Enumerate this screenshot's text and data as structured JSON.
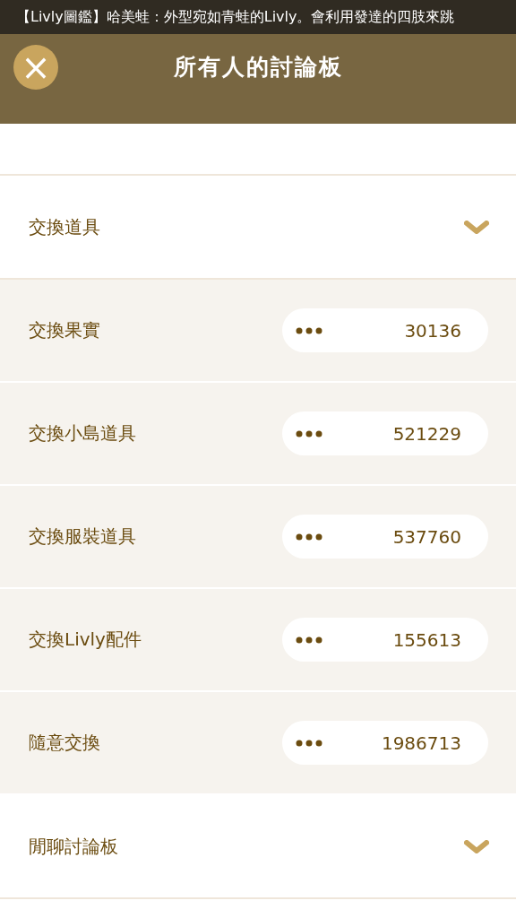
{
  "ticker": "【Livly圖鑑】哈美蛙：外型宛如青蛙的Livly。會利用發達的四肢來跳",
  "header": {
    "close_icon": "×",
    "title": "所有人的討論板"
  },
  "categories": [
    {
      "label": "交換道具",
      "children": [
        {
          "label": "交換果實",
          "count": "30136"
        },
        {
          "label": "交換小島道具",
          "count": "521229"
        },
        {
          "label": "交換服裝道具",
          "count": "537760"
        },
        {
          "label": "交換Livly配件",
          "count": "155613"
        },
        {
          "label": "隨意交換",
          "count": "1986713"
        }
      ]
    },
    {
      "label": "閒聊討論板"
    }
  ]
}
